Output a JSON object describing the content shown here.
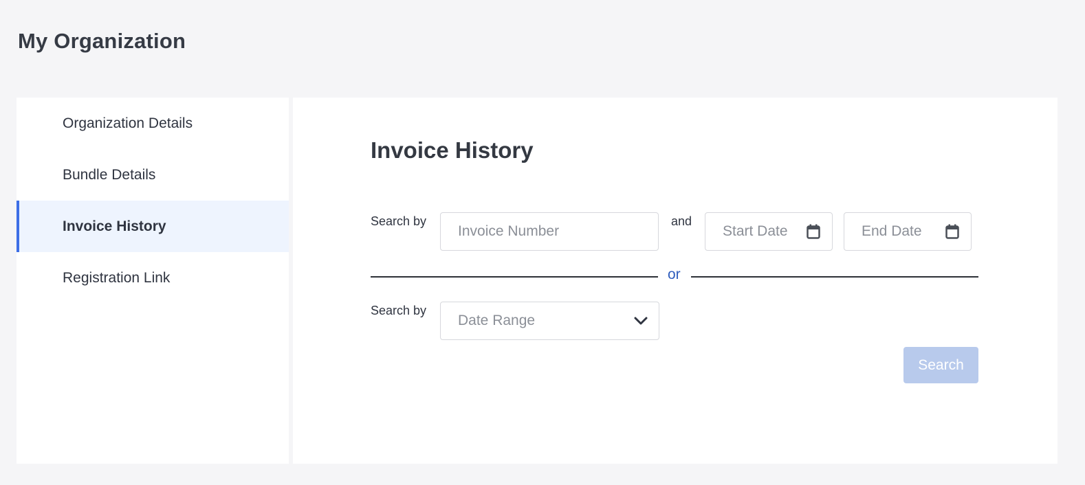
{
  "page": {
    "title": "My Organization"
  },
  "sidebar": {
    "items": [
      {
        "label": "Organization Details",
        "active": false
      },
      {
        "label": "Bundle Details",
        "active": false
      },
      {
        "label": "Invoice History",
        "active": true
      },
      {
        "label": "Registration Link",
        "active": false
      }
    ]
  },
  "main": {
    "title": "Invoice History",
    "search_row_1": {
      "label": "Search by",
      "invoice_placeholder": "Invoice Number",
      "and_label": "and",
      "start_date_placeholder": "Start Date",
      "end_date_placeholder": "End Date",
      "date_icon": "calendar-icon"
    },
    "or_label": "or",
    "search_row_2": {
      "label": "Search by",
      "range_select_value": "Date Range",
      "select_icon": "chevron-down-icon"
    },
    "search_button": "Search"
  },
  "colors": {
    "accent": "#3d6ee6",
    "active_bg": "#eef4fe",
    "or_text": "#2f5dbd",
    "button_disabled": "#b8caec"
  }
}
